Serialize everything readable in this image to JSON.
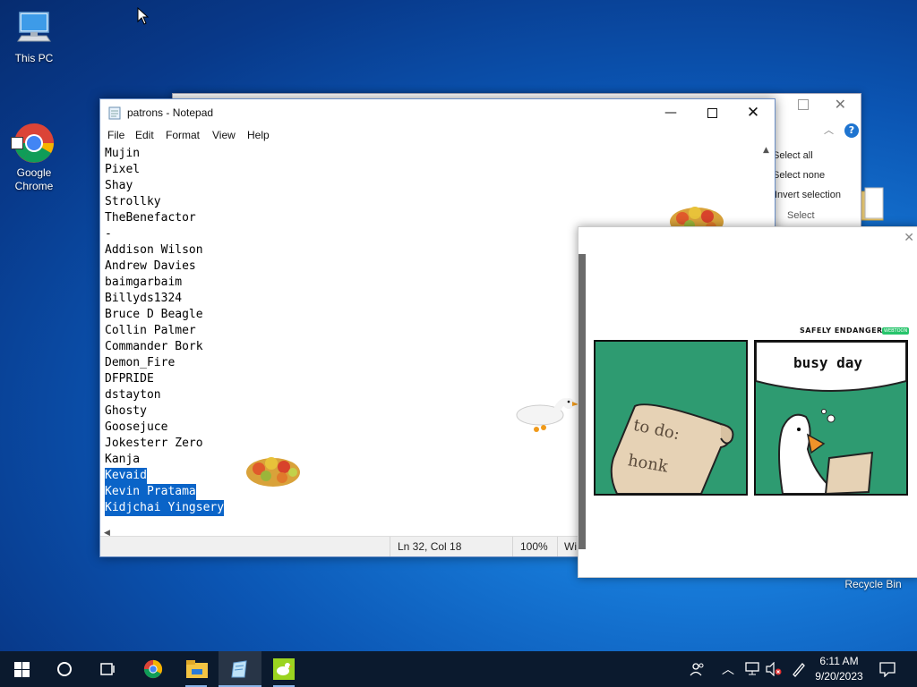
{
  "desktop": {
    "icons": [
      {
        "label": "This PC",
        "icon": "computer-icon"
      },
      {
        "label": "Google\nChrome",
        "icon": "chrome-icon"
      },
      {
        "label": "Recycle Bin",
        "icon": "recycle-bin-icon"
      }
    ]
  },
  "explorer": {
    "ribbon": [
      "Select all",
      "Select none",
      "Invert selection",
      "Select"
    ]
  },
  "notepad": {
    "title": "patrons - Notepad",
    "menu": [
      "File",
      "Edit",
      "Format",
      "View",
      "Help"
    ],
    "lines": [
      "Mujin",
      "Pixel",
      "Shay",
      "Strollky",
      "TheBenefactor",
      "-",
      "Addison Wilson",
      "Andrew Davies",
      "baimgarbaim",
      "Billyds1324",
      "Bruce D Beagle",
      "Collin Palmer",
      "Commander Bork",
      "Demon_Fire",
      "DFPRIDE",
      "dstayton",
      "Ghosty",
      "Goosejuce",
      "Jokesterr Zero",
      "Kanja",
      "Kevaid",
      "Kevin Pratama",
      "Kidjchai Yingsery"
    ],
    "selected_lines": [
      "Kevaid",
      "Kevin Pratama",
      "Kidjchai Yingsery"
    ],
    "status": {
      "position": "Ln 32, Col 18",
      "zoom": "100%",
      "encoding": "Wi"
    }
  },
  "comic": {
    "header": "SAFELY ENDANGERED",
    "badge": "WEBTOON",
    "panel1_text": [
      "to do:",
      "honk"
    ],
    "panel2_title": "busy day"
  },
  "taskbar": {
    "time": "6:11 AM",
    "date": "9/20/2023",
    "apps": [
      "start-icon",
      "search-icon",
      "task-view-icon",
      "chrome-icon",
      "file-explorer-icon",
      "notepad-icon",
      "goose-icon"
    ],
    "active_app": "notepad-icon"
  }
}
